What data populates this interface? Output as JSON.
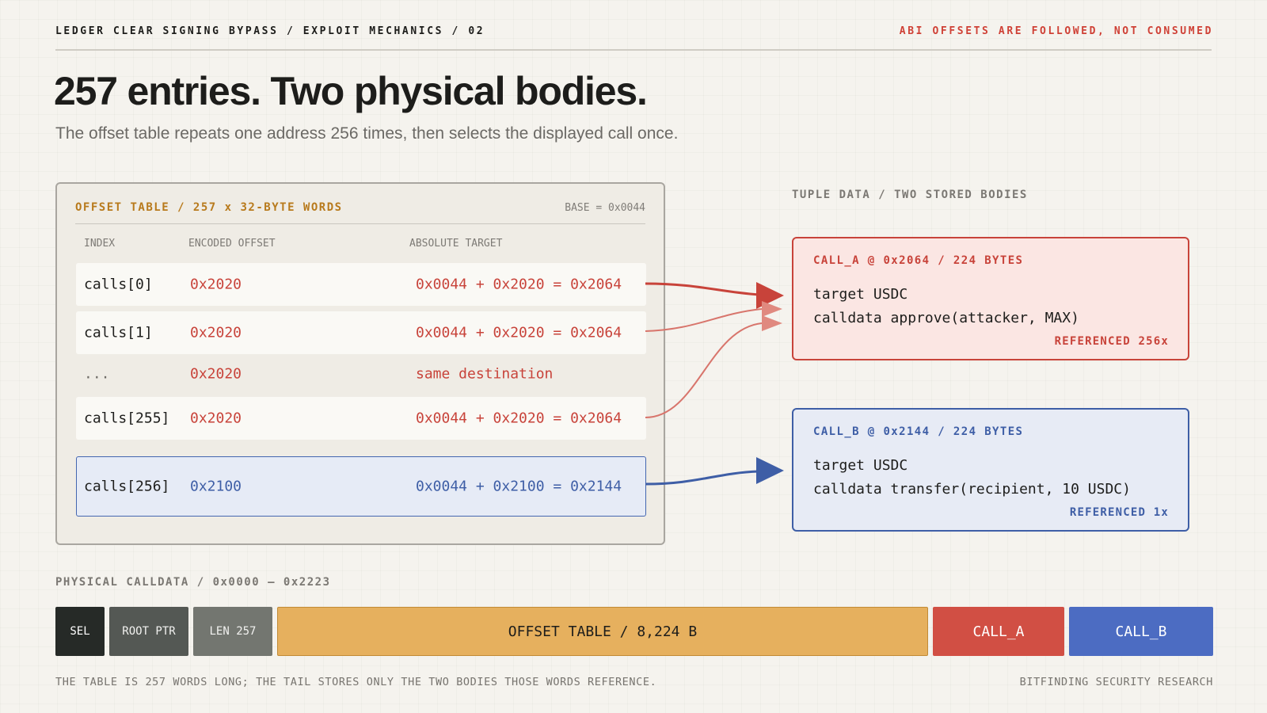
{
  "header": {
    "breadcrumb": "LEDGER CLEAR SIGNING BYPASS / EXPLOIT MECHANICS / 02",
    "tagline": "ABI OFFSETS ARE FOLLOWED, NOT CONSUMED"
  },
  "title": "257 entries. Two physical bodies.",
  "subtitle": "The offset table repeats one address 256 times, then selects the displayed call once.",
  "offset_table": {
    "heading": "OFFSET TABLE / 257 x 32-BYTE WORDS",
    "base": "BASE = 0x0044",
    "columns": {
      "index": "INDEX",
      "encoded": "ENCODED OFFSET",
      "absolute": "ABSOLUTE TARGET"
    },
    "rows": [
      {
        "index": "calls[0]",
        "offset": "0x2020",
        "target": "0x0044 + 0x2020 = 0x2064"
      },
      {
        "index": "calls[1]",
        "offset": "0x2020",
        "target": "0x0044 + 0x2020 = 0x2064"
      },
      {
        "index": "...",
        "offset": "0x2020",
        "target": "same destination"
      },
      {
        "index": "calls[255]",
        "offset": "0x2020",
        "target": "0x0044 + 0x2020 = 0x2064"
      },
      {
        "index": "calls[256]",
        "offset": "0x2100",
        "target": "0x0044 + 0x2100 = 0x2144"
      }
    ]
  },
  "tuple_data": {
    "heading": "TUPLE DATA / TWO STORED BODIES",
    "call_a": {
      "heading": "CALL_A @ 0x2064 / 224 BYTES",
      "target": "target USDC",
      "calldata": "calldata approve(attacker, MAX)",
      "referenced": "REFERENCED 256x"
    },
    "call_b": {
      "heading": "CALL_B @ 0x2144 / 224 BYTES",
      "target": "target USDC",
      "calldata": "calldata transfer(recipient, 10 USDC)",
      "referenced": "REFERENCED 1x"
    }
  },
  "physical_calldata": {
    "heading": "PHYSICAL CALLDATA / 0x0000 – 0x2223",
    "segments": {
      "sel": "SEL",
      "root_ptr": "ROOT PTR",
      "len": "LEN 257",
      "offset_table": "OFFSET TABLE / 8,224 B",
      "call_a": "CALL_A",
      "call_b": "CALL_B"
    }
  },
  "footer": {
    "note": "THE TABLE IS 257 WORDS LONG; THE TAIL STORES ONLY THE TWO BODIES THOSE WORDS REFERENCE.",
    "credit": "BITFINDING SECURITY RESEARCH"
  },
  "colors": {
    "red": "#c8433a",
    "blue": "#3e5ea6",
    "amber": "#e6b05e",
    "background": "#f5f3ee"
  }
}
